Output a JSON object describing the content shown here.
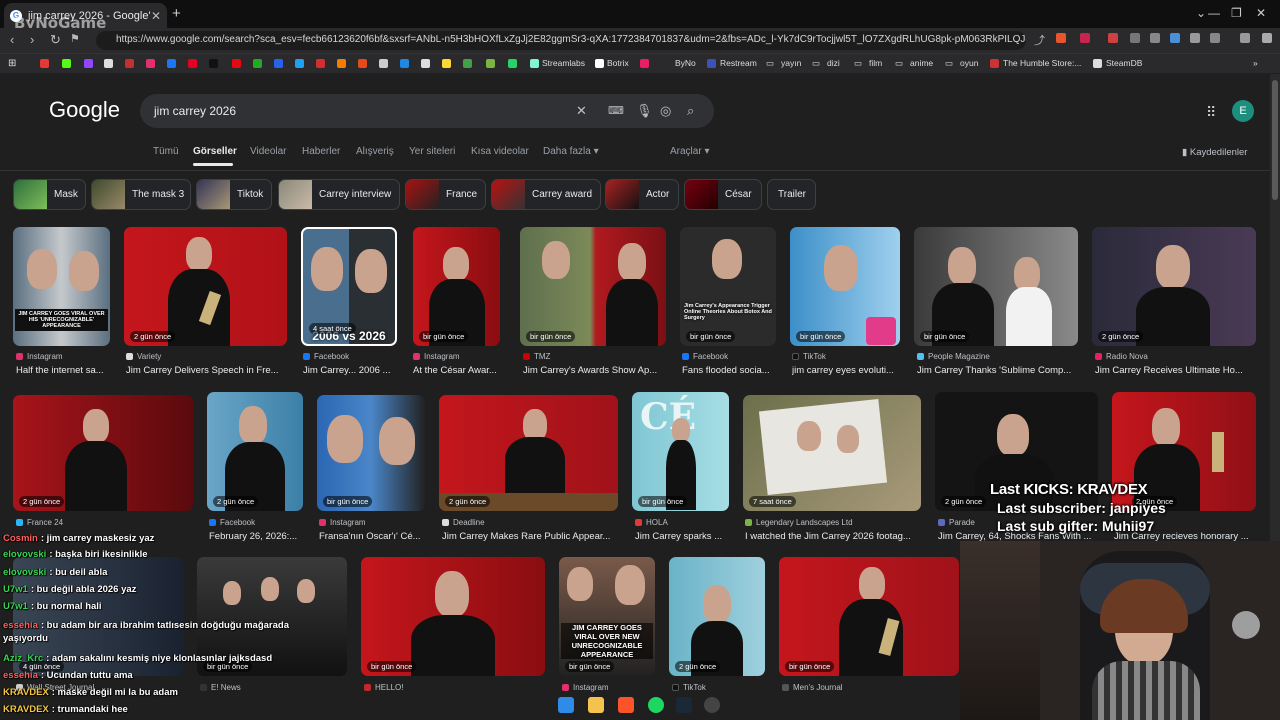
{
  "browser": {
    "tab_title": "jim carrey 2026 - Google'da Ara",
    "url": "https://www.google.com/search?sca_esv=fecb66123620f6bf&sxsrf=ANbL-n5H3bHOXfLxZgJj2E82ggmSr3-qXA:1772384701837&udm=2&fbs=ADc_l-Yk7dC9rTocjjwl5T_lO7ZXgdRLhUG8pk-pM063RkPILQJoVswXu7Xoldd5...",
    "watermark": "ByNoGame",
    "bookmarks": [
      "Streamlabs",
      "Botrix",
      "ByNo",
      "Restream",
      "yayın",
      "dizi",
      "film",
      "anime",
      "oyun",
      "The Humble Store:...",
      "SteamDB"
    ]
  },
  "google": {
    "logo": "Google",
    "query": "jim carrey 2026",
    "avatar_letter": "E",
    "nav": [
      "Tümü",
      "Görseller",
      "Videolar",
      "Haberler",
      "Alışveriş",
      "Yer siteleri",
      "Kısa videolar",
      "Daha fazla"
    ],
    "tools": "Araçlar",
    "saved": "Kaydedilenler",
    "chips": [
      "Mask",
      "The mask 3",
      "Tiktok",
      "Carrey interview",
      "France",
      "Carrey award",
      "Actor",
      "César",
      "Trailer"
    ]
  },
  "results_row1": [
    {
      "time": "",
      "source": "Instagram",
      "caption": "Half the internet sa...",
      "overlay": "JIM CARREY GOES VIRAL OVER HIS 'UNRECOGNIZABLE' APPEARANCE"
    },
    {
      "time": "2 gün önce",
      "source": "Variety",
      "caption": "Jim Carrey Delivers Speech in Fre...",
      "overlay": ""
    },
    {
      "time": "4 saat önce",
      "source": "Facebook",
      "caption": "Jim Carrey... 2006 ...",
      "overlay": "2006 vs 2026"
    },
    {
      "time": "bir gün önce",
      "source": "Instagram",
      "caption": "At the César Awar...",
      "overlay": ""
    },
    {
      "time": "bir gün önce",
      "source": "TMZ",
      "caption": "Jim Carrey's Awards Show Ap...",
      "overlay": ""
    },
    {
      "time": "bir gün önce",
      "source": "Facebook",
      "caption": "Fans flooded socia...",
      "overlay": "Jim Carrey's Appearance Trigger Online Theories About Botox And Surgery"
    },
    {
      "time": "bir gün önce",
      "source": "TikTok",
      "caption": "jim carrey eyes evoluti...",
      "overlay": ""
    },
    {
      "time": "bir gün önce",
      "source": "People Magazine",
      "caption": "Jim Carrey Thanks 'Sublime Comp...",
      "overlay": ""
    },
    {
      "time": "2 gün önce",
      "source": "Radio Nova",
      "caption": "Jim Carrey Receives Ultimate Ho...",
      "overlay": ""
    }
  ],
  "results_row2": [
    {
      "time": "2 gün önce",
      "source": "France 24",
      "caption": "Jim Carrey maskesiz yaz..."
    },
    {
      "time": "2 gün önce",
      "source": "Facebook",
      "caption": "February 26, 2026:..."
    },
    {
      "time": "bir gün önce",
      "source": "Instagram",
      "caption": "Fransa'nın Oscar'ı' Cé..."
    },
    {
      "time": "2 gün önce",
      "source": "Deadline",
      "caption": "Jim Carrey Makes Rare Public Appear..."
    },
    {
      "time": "bir gün önce",
      "source": "HOLA",
      "caption": "Jim Carrey sparks ..."
    },
    {
      "time": "7 saat önce",
      "source": "Legendary Landscapes Ltd",
      "caption": "I watched the Jim Carrey 2026 footag..."
    },
    {
      "time": "2 gün önce",
      "source": "Parade",
      "caption": "Jim Carrey, 64, Shocks Fans With ..."
    },
    {
      "time": "2 gün önce",
      "source": "",
      "caption": "Jim Carrey recieves honorary ..."
    }
  ],
  "results_row3": [
    {
      "time": "4 gün önce",
      "source": "Wall Street Journal"
    },
    {
      "time": "bir gün önce",
      "source": "E! News"
    },
    {
      "time": "bir gün önce",
      "source": "HELLO!"
    },
    {
      "time": "bir gün önce",
      "source": "Instagram",
      "overlay": "JIM CARREY GOES VIRAL OVER NEW UNRECOGNIZABLE APPEARANCE"
    },
    {
      "time": "2 gün önce",
      "source": "TikTok"
    },
    {
      "time": "bir gün önce",
      "source": "Men's Journal"
    }
  ],
  "stream": {
    "last_kicks": "Last KICKS: KRAVDEX",
    "last_sub": "Last subscriber: janpiyes",
    "last_gift": "Last sub gifter: Muhii97",
    "chat": [
      {
        "user": "Cosmin",
        "msg": ": jim carrey maskesiz yaz",
        "color": "#ff5e5e"
      },
      {
        "user": "elovovski",
        "msg": ": başka biri ikesinlikle",
        "color": "#39d353"
      },
      {
        "user": "elovovski",
        "msg": ": bu deil abla",
        "color": "#39d353"
      },
      {
        "user": "U7w1",
        "msg": ": bu değil abla 2026 yaz",
        "color": "#39d353"
      },
      {
        "user": "U7w1",
        "msg": ": bu normal hali",
        "color": "#39d353"
      },
      {
        "user": "essehia",
        "msg": ": bu adam bir ara ibrahim tatlısesin doğduğu mağarada yaşıyordu",
        "color": "#ff5e5e"
      },
      {
        "user": "Aziz_Krc",
        "msg": ": adam sakalını kesmiş niye klonlasınlar jajksdasd",
        "color": "#39d353"
      },
      {
        "user": "essehia",
        "msg": ": Ucundan tuttu ama",
        "color": "#ff5e5e"
      },
      {
        "user": "KRAVDEX",
        "msg": ": maske değil mi la bu adam",
        "color": "#f5c542"
      },
      {
        "user": "KRAVDEX",
        "msg": ": trumandaki hee",
        "color": "#f5c542"
      }
    ]
  }
}
